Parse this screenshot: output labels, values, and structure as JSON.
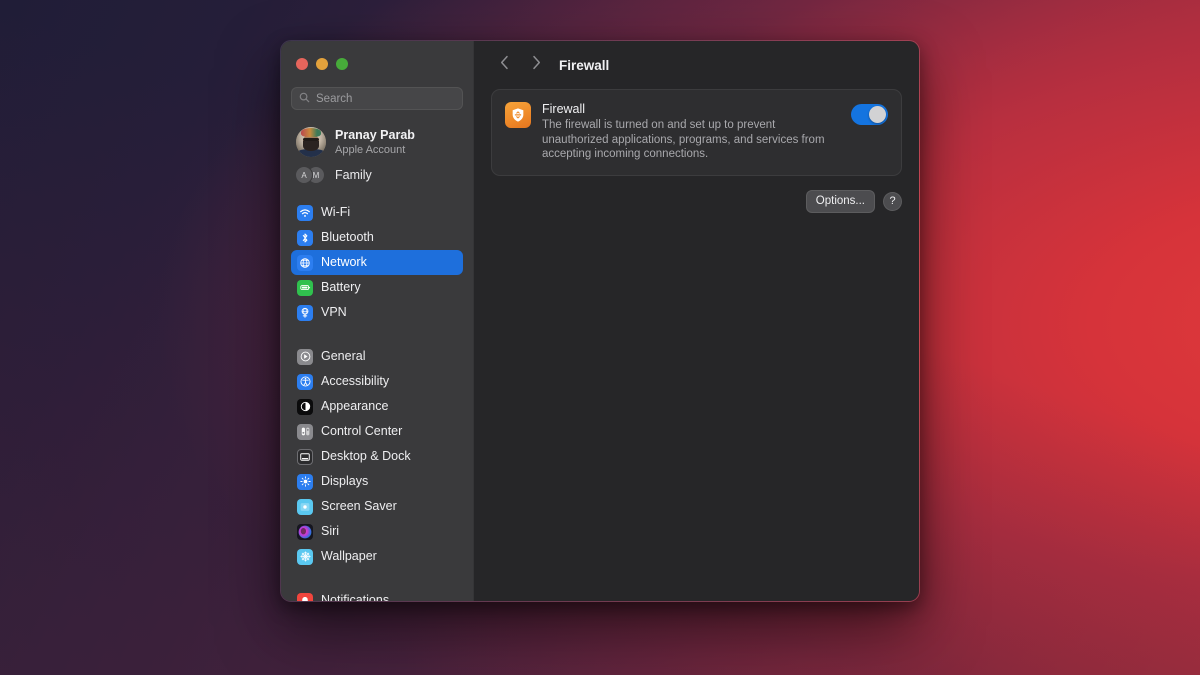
{
  "desktop": {
    "wallpaper_colors": {
      "top_left": "#211e38",
      "bottom_left": "#402038",
      "right": "#cd2f38",
      "accent_red": "#d63a39"
    }
  },
  "window": {
    "traffic_lights": [
      {
        "name": "close",
        "color": "#e5655c"
      },
      {
        "name": "minimize",
        "color": "#e3a23c"
      },
      {
        "name": "maximize",
        "color": "#47ab3a"
      }
    ],
    "sidebar_bg": "#3a3a3c",
    "content_bg": "#262628"
  },
  "sidebar": {
    "search": {
      "placeholder": "Search",
      "value": "",
      "icon": "search-icon"
    },
    "account": {
      "name": "Pranay Parab",
      "subtitle": "Apple Account",
      "avatar": "user-avatar"
    },
    "family": {
      "label": "Family",
      "badges": [
        "A",
        "M"
      ]
    },
    "groups": [
      {
        "items": [
          {
            "label": "Wi-Fi",
            "icon": "wifi-icon",
            "color": "#2c7ef0",
            "selected": false
          },
          {
            "label": "Bluetooth",
            "icon": "bluetooth-icon",
            "color": "#2c7ef0",
            "selected": false
          },
          {
            "label": "Network",
            "icon": "network-globe-icon",
            "color": "#2c7ef0",
            "selected": true
          },
          {
            "label": "Battery",
            "icon": "battery-icon",
            "color": "#30c14e",
            "selected": false
          },
          {
            "label": "VPN",
            "icon": "vpn-icon",
            "color": "#2c7ef0",
            "selected": false
          }
        ]
      },
      {
        "items": [
          {
            "label": "General",
            "icon": "general-gear-icon",
            "color": "#8a8a8e",
            "selected": false
          },
          {
            "label": "Accessibility",
            "icon": "accessibility-icon",
            "color": "#2c7ef0",
            "selected": false
          },
          {
            "label": "Appearance",
            "icon": "appearance-icon",
            "color": "#0b0b0c",
            "selected": false
          },
          {
            "label": "Control Center",
            "icon": "control-center-icon",
            "color": "#8a8a8e",
            "selected": false
          },
          {
            "label": "Desktop & Dock",
            "icon": "desktop-dock-icon",
            "color": "#2b2b2d",
            "selected": false
          },
          {
            "label": "Displays",
            "icon": "displays-icon",
            "color": "#2c7ef0",
            "selected": false
          },
          {
            "label": "Screen Saver",
            "icon": "screen-saver-icon",
            "color": "#5ac8f0",
            "selected": false
          },
          {
            "label": "Siri",
            "icon": "siri-icon",
            "color": "#1b1b2e",
            "selected": false
          },
          {
            "label": "Wallpaper",
            "icon": "wallpaper-icon",
            "color": "#5ac8f0",
            "selected": false
          }
        ]
      },
      {
        "items": [
          {
            "label": "Notifications",
            "icon": "notifications-bell-icon",
            "color": "#f1453d",
            "selected": false
          }
        ]
      }
    ]
  },
  "content": {
    "toolbar": {
      "back_icon": "chevron-left-icon",
      "forward_icon": "chevron-right-icon",
      "title": "Firewall"
    },
    "firewall_card": {
      "icon": "firewall-shield-icon",
      "icon_color": "#ef8b2a",
      "title": "Firewall",
      "description": "The firewall is turned on and set up to prevent unauthorized applications, programs, and services from accepting incoming connections.",
      "toggle": {
        "state": "on",
        "on_color": "#1474e0",
        "knob_color": "#d2d2d4"
      }
    },
    "actions": {
      "options_label": "Options...",
      "help_label": "?"
    }
  }
}
